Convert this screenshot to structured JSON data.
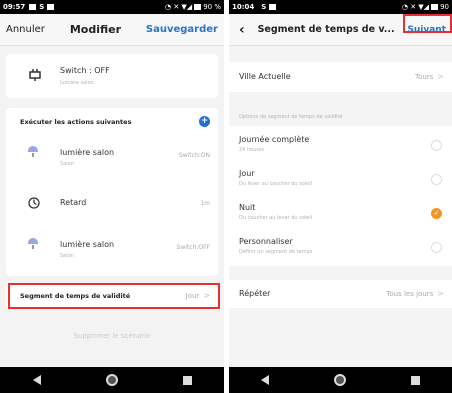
{
  "left": {
    "status": {
      "time": "09:57",
      "battery": "90 %"
    },
    "nav": {
      "left": "Annuler",
      "title": "Modifier",
      "right": "Sauvegarder"
    },
    "condition": {
      "title": "Switch : OFF",
      "subtitle": "lumière salon"
    },
    "actions_header": "Exécuter les actions suivantes",
    "actions": [
      {
        "title": "lumière salon",
        "subtitle": "Salon",
        "value": "Switch:ON",
        "icon": "lamp-icon"
      },
      {
        "title": "Retard",
        "subtitle": "",
        "value": "1m",
        "icon": "timer-icon"
      },
      {
        "title": "lumière salon",
        "subtitle": "Salon",
        "value": "Switch:OFF",
        "icon": "lamp-icon"
      }
    ],
    "segment": {
      "label": "Segment de temps de validité",
      "value": "Jour"
    },
    "delete_label": "Supprimer le scénario"
  },
  "right": {
    "status": {
      "time": "10:04",
      "battery": "90"
    },
    "nav": {
      "title": "Segment de temps de v...",
      "right": "Suivant"
    },
    "city": {
      "label": "Ville Actuelle",
      "value": "Tours"
    },
    "options_header": "Options de segment de temps de validité",
    "options": [
      {
        "title": "Journée complète",
        "subtitle": "24 heures",
        "selected": false
      },
      {
        "title": "Jour",
        "subtitle": "Du lever au coucher du soleil",
        "selected": false
      },
      {
        "title": "Nuit",
        "subtitle": "Du coucher au lever du soleil",
        "selected": true
      },
      {
        "title": "Personnaliser",
        "subtitle": "Définir un segment de temps",
        "selected": false
      }
    ],
    "repeat": {
      "label": "Répéter",
      "value": "Tous les jours"
    }
  },
  "colors": {
    "accent": "#2a73c9",
    "highlight": "#e53030",
    "selected": "#f2962b",
    "plus": "#1f6fd0"
  }
}
